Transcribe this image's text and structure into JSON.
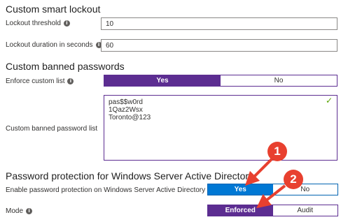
{
  "lockout": {
    "title": "Custom smart lockout",
    "threshold_label": "Lockout threshold",
    "threshold_value": "10",
    "duration_label": "Lockout duration in seconds",
    "duration_value": "60"
  },
  "banned": {
    "title": "Custom banned passwords",
    "enforce_label": "Enforce custom list",
    "enforce_yes": "Yes",
    "enforce_no": "No",
    "enforce_selected": "Yes",
    "list_label": "Custom banned password list",
    "list_items": [
      "pas$$w0rd",
      "1Qaz2Wsx",
      "Toronto@123"
    ],
    "valid_icon": "checkmark-icon"
  },
  "ad": {
    "title": "Password protection for Windows Server Active Directory",
    "enable_label": "Enable password protection on Windows Server Active Directory",
    "enable_yes": "Yes",
    "enable_no": "No",
    "enable_selected": "Yes",
    "mode_label": "Mode",
    "mode_enforced": "Enforced",
    "mode_audit": "Audit",
    "mode_selected": "Enforced"
  },
  "annotations": {
    "step1": "1",
    "step2": "2"
  },
  "colors": {
    "purple_accent": "#5c2d91",
    "blue_accent": "#0078d4",
    "annotation_red": "#e8402f",
    "check_green": "#57a300"
  }
}
